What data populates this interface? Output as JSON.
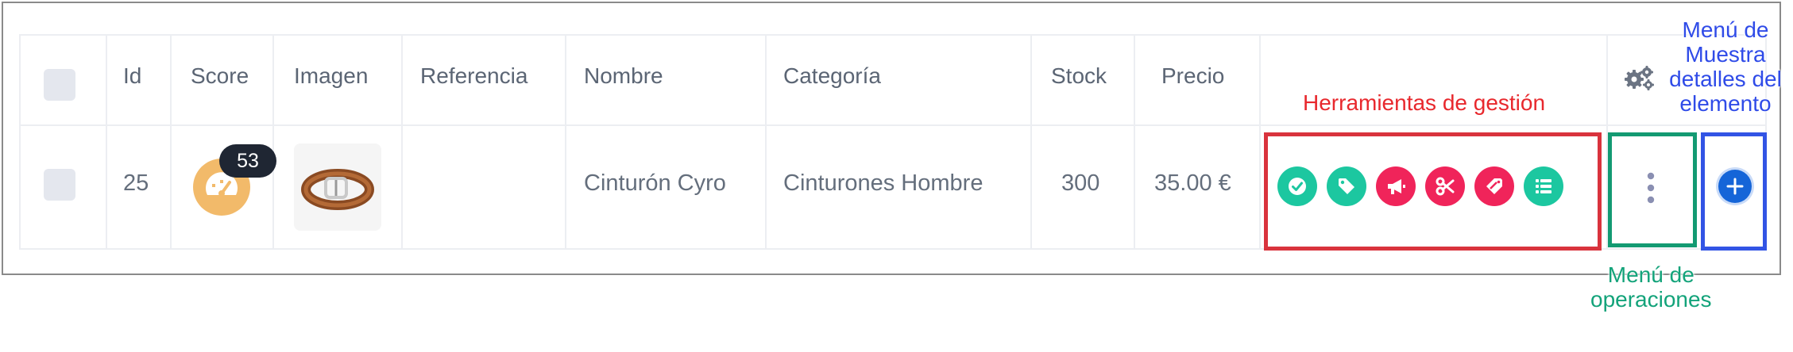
{
  "table": {
    "headers": {
      "id": "Id",
      "score": "Score",
      "imagen": "Imagen",
      "referencia": "Referencia",
      "nombre": "Nombre",
      "categoria": "Categoría",
      "stock": "Stock",
      "precio": "Precio"
    },
    "row": {
      "id": "25",
      "score": "53",
      "referencia": "",
      "nombre": "Cinturón Cyro",
      "categoria": "Cinturones Hombre",
      "stock": "300",
      "precio": "35.00 €"
    }
  },
  "tools": [
    "check-circle-icon",
    "tag-icon",
    "megaphone-icon",
    "scissors-icon",
    "tag-edit-icon",
    "list-icon"
  ],
  "annotations": {
    "herramientas": "Herramientas de gestión",
    "operaciones": [
      "Menú de",
      "operaciones"
    ],
    "detalles": [
      "Menú de",
      "Muestra",
      "detalles del",
      "elemento"
    ]
  },
  "colors": {
    "tool_green": "#1cc7a0",
    "tool_red": "#f0245a",
    "score_badge": "#f2ba6a",
    "detail_button": "#1565d8",
    "annotation_red": "#e8282d",
    "annotation_green": "#13a37a",
    "annotation_blue": "#2f4be8"
  }
}
